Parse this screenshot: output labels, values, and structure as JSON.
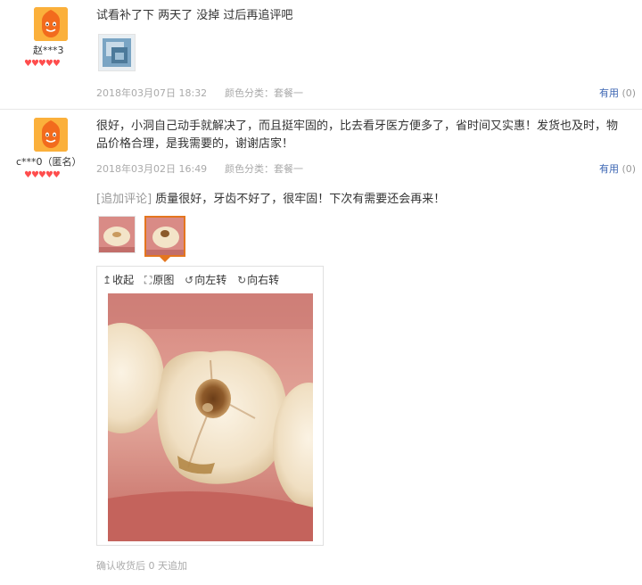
{
  "reviews": [
    {
      "username": "赵***3",
      "hearts": "♥♥♥♥♥",
      "content": "试看补了下 两天了 没掉 过后再追评吧",
      "date": "2018年03月07日 18:32",
      "variant": "颜色分类：套餐一",
      "useful_label": "有用",
      "useful_count": "(0)"
    },
    {
      "username": "c***0（匿名）",
      "hearts": "♥♥♥♥♥",
      "content_line1": "很好，小洞自己动手就解决了，而且挺牢固的，比去看牙医方便多了，省时间又实惠！发货也及时，物",
      "content_line2": "品价格合理，是我需要的，谢谢店家！",
      "date": "2018年03月02日 16:49",
      "variant": "颜色分类：套餐一",
      "useful_label": "有用",
      "useful_count": "(0)",
      "append_tag": "[追加评论]",
      "append_text": "质量很好，牙齿不好了，很牢固！下次有需要还会再来！",
      "viewer": {
        "collapse": "收起",
        "original": "原图",
        "rotate_left": "向左转",
        "rotate_right": "向右转"
      },
      "confirm_text": "确认收货后 0 天追加"
    }
  ],
  "colors": {
    "link_blue": "#3c66b3",
    "meta_gray": "#aaaaaa",
    "active_border": "#e4761f",
    "heart_red": "#ff4d4d",
    "avatar_orange": "#f5a623"
  }
}
